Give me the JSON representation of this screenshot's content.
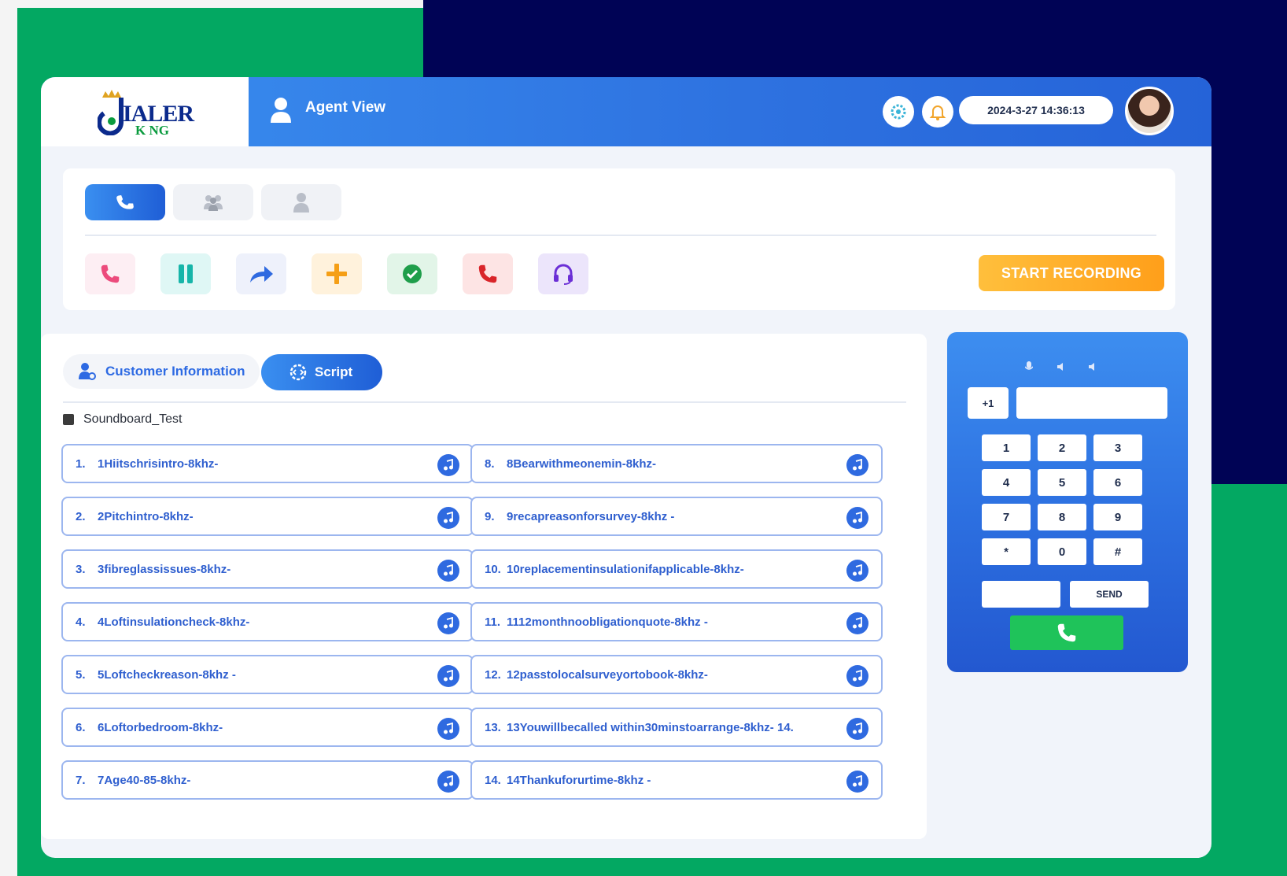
{
  "brand": {
    "logo_text_top": "IALER",
    "logo_text_bottom": "K NG",
    "colors": {
      "green": "#03a862",
      "navy": "#000355",
      "primary": "#2e72e0",
      "accent_orange": "#ff9f1a"
    }
  },
  "header": {
    "title": "Agent View",
    "datetime": "2024-3-27 14:36:13",
    "icons": [
      "user-icon",
      "settings-icon",
      "bell-icon",
      "avatar"
    ]
  },
  "modes": [
    "phone-icon",
    "group-icon",
    "single-user-icon"
  ],
  "actions": [
    "call-icon",
    "pause-icon",
    "forward-icon",
    "add-icon",
    "check-icon",
    "hangup-icon",
    "headset-icon"
  ],
  "record": {
    "label": "START RECORDING"
  },
  "tabs": {
    "customer_info": "Customer Information",
    "script": "Script"
  },
  "soundboard": {
    "title": "Soundboard_Test",
    "items": [
      {
        "num": "1.",
        "label": "1Hiitschrisintro-8khz-"
      },
      {
        "num": "2.",
        "label": "2Pitchintro-8khz-"
      },
      {
        "num": "3.",
        "label": "3fibreglassissues-8khz-"
      },
      {
        "num": "4.",
        "label": "4Loftinsulationcheck-8khz-"
      },
      {
        "num": "5.",
        "label": "5Loftcheckreason-8khz -"
      },
      {
        "num": "6.",
        "label": "6Loftorbedroom-8khz-"
      },
      {
        "num": "7.",
        "label": "7Age40-85-8khz-"
      },
      {
        "num": "8.",
        "label": "8Bearwithmeonemin-8khz-"
      },
      {
        "num": "9.",
        "label": "9recapreasonforsurvey-8khz -"
      },
      {
        "num": "10.",
        "label": "10replacementinsulationifapplicable-8khz-"
      },
      {
        "num": "11.",
        "label": "1112monthnoobligationquote-8khz -"
      },
      {
        "num": "12.",
        "label": "12passtolocalsurveyortobook-8khz-"
      },
      {
        "num": "13.",
        "label": "13Youwillbecalled within30minstoarrange-8khz- 14."
      },
      {
        "num": "14.",
        "label": "14Thankuforurtime-8khz -"
      }
    ]
  },
  "dialer": {
    "country_code": "+1",
    "keys": [
      "1",
      "2",
      "3",
      "4",
      "5",
      "6",
      "7",
      "8",
      "9",
      "*",
      "0",
      "#"
    ],
    "send_label": "SEND"
  }
}
